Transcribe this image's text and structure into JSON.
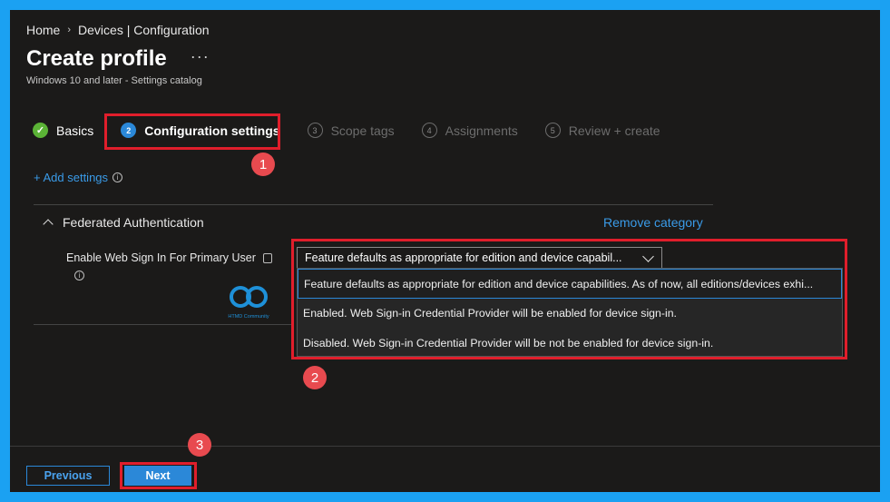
{
  "breadcrumb": {
    "home": "Home",
    "separator": "›",
    "current": "Devices | Configuration"
  },
  "page": {
    "title": "Create profile",
    "more": "···",
    "subtitle": "Windows 10 and later - Settings catalog"
  },
  "steps": [
    {
      "num": "✓",
      "label": "Basics",
      "state": "done"
    },
    {
      "num": "2",
      "label": "Configuration settings",
      "state": "active"
    },
    {
      "num": "3",
      "label": "Scope tags",
      "state": "pending"
    },
    {
      "num": "4",
      "label": "Assignments",
      "state": "pending"
    },
    {
      "num": "5",
      "label": "Review + create",
      "state": "pending"
    }
  ],
  "add_settings": {
    "label": "+ Add settings",
    "info": "i"
  },
  "category": {
    "name": "Federated Authentication",
    "remove_label": "Remove category"
  },
  "setting": {
    "label": "Enable Web Sign In For Primary User",
    "info": "i",
    "selected_value": "Feature defaults as appropriate for edition and device capabil...",
    "options": [
      "Feature defaults as appropriate for edition and device capabilities. As of now, all editions/devices exhi...",
      "Enabled. Web Sign-in Credential Provider will be enabled for device sign-in.",
      "Disabled. Web Sign-in Credential Provider will be not be enabled for device sign-in."
    ]
  },
  "logo": {
    "text": "HTMD Community"
  },
  "annotations": [
    "1",
    "2",
    "3"
  ],
  "footer": {
    "previous_label": "Previous",
    "next_label": "Next"
  },
  "colors": {
    "accent": "#2b88d8",
    "link": "#3a9be8",
    "highlight": "#e01e2b",
    "badge": "#e84a4f",
    "success": "#5bb336",
    "background": "#1b1a19"
  }
}
